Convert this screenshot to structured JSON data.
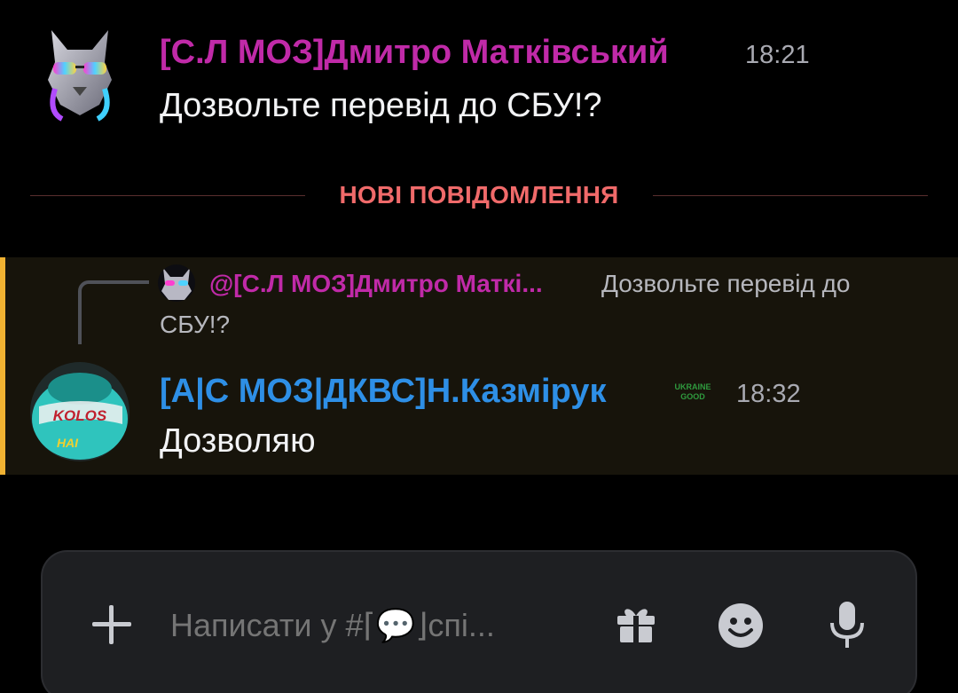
{
  "messages": [
    {
      "author": "[С.Л МОЗ]Дмитро Матківський",
      "time": "18:21",
      "text": "Дозвольте перевід до СБУ!?",
      "author_color": "#c02aa8"
    },
    {
      "reply": {
        "author": "@[С.Л МОЗ]Дмитро Маткі...",
        "text_line1": "Дозвольте перевід до",
        "text_line2": "СБУ!?"
      },
      "author": "[А|С МОЗ|ДКВС]Н.Казмірук",
      "time": "18:32",
      "text": "Дозволяю",
      "author_color": "#2e8fe6",
      "avatar_text_top": "KOLOS",
      "avatar_text_bottom": "HAI",
      "badge_text_top": "UKRAINE",
      "badge_text_bottom": "GOOD"
    }
  ],
  "divider": {
    "label": "НОВІ ПОВІДОМЛЕННЯ"
  },
  "composer": {
    "placeholder": "Написати у #⌈💬⌋спі..."
  },
  "colors": {
    "background": "#000000",
    "highlight_bar": "#f0b232",
    "divider_text": "#f06a6a"
  },
  "icons": [
    "plus-icon",
    "gift-icon",
    "emoji-icon",
    "microphone-icon"
  ]
}
